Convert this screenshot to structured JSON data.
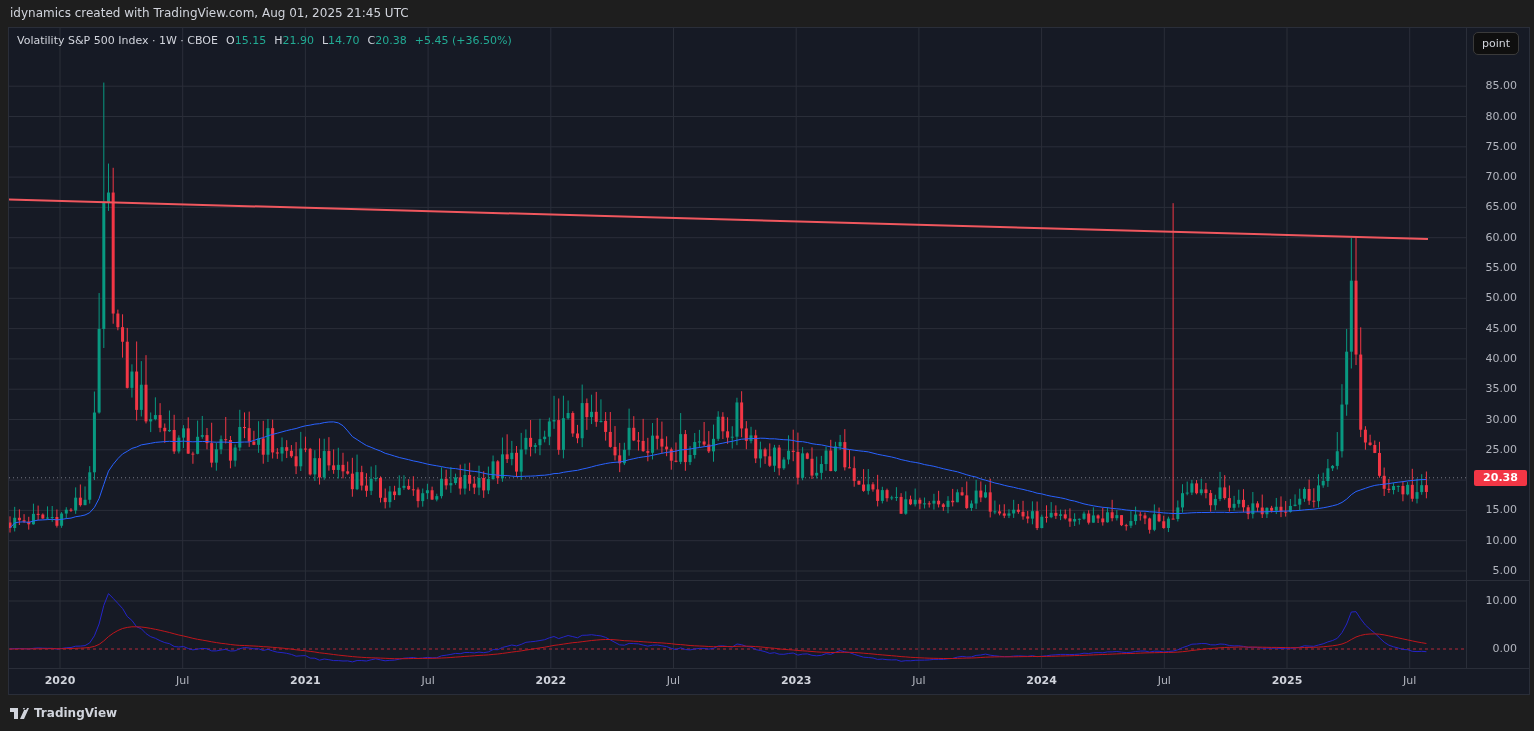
{
  "header": {
    "text": "idynamics created with TradingView.com, Aug 01, 2025 21:45 UTC"
  },
  "legend": {
    "title": "Volatility S&P 500 Index · 1W · CBOE",
    "ohlc": [
      {
        "label": "O",
        "value": "15.15"
      },
      {
        "label": "H",
        "value": "21.90"
      },
      {
        "label": "L",
        "value": "14.70"
      },
      {
        "label": "C",
        "value": "20.38"
      }
    ],
    "change": "+5.45 (+36.50%)"
  },
  "point_button": {
    "label": "point"
  },
  "price_axis": [
    "85.00",
    "80.00",
    "75.00",
    "70.00",
    "65.00",
    "60.00",
    "55.00",
    "50.00",
    "45.00",
    "40.00",
    "35.00",
    "30.00",
    "25.00",
    "15.00",
    "10.00",
    "5.00"
  ],
  "current_price": "20.38",
  "indicator_axis": [
    "10.00",
    "0.00"
  ],
  "time_axis": [
    "2020",
    "Jul",
    "2021",
    "Jul",
    "2022",
    "Jul",
    "2023",
    "Jul",
    "2024",
    "Jul",
    "2025",
    "Jul"
  ],
  "footer": {
    "brand": "TradingView"
  }
}
